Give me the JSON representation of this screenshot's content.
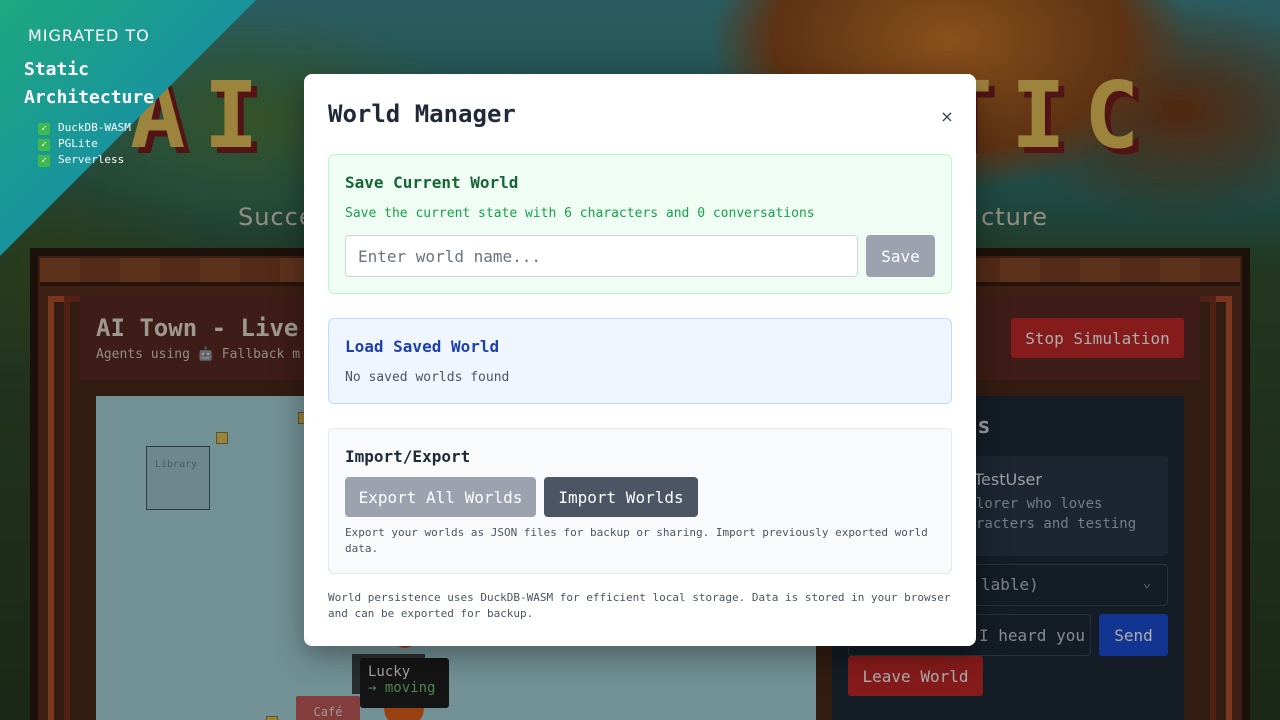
{
  "ribbon": {
    "top": "MIGRATED TO",
    "headline_1": "Static",
    "headline_2": "Architecture",
    "items": [
      "DuckDB-WASM",
      "PGLite",
      "Serverless"
    ]
  },
  "background": {
    "title": "AI TOWN STATIC",
    "subtitle_start": "Succe",
    "subtitle_end": "cture"
  },
  "simulation": {
    "title": "AI Town - Live",
    "subtitle": "Agents using 🤖 Fallback m",
    "stop_label": "Stop Simulation",
    "map": {
      "library_label": "Library",
      "cafe_label": "Café",
      "tooltip_name": "Lucky",
      "tooltip_status": "→ moving"
    },
    "side": {
      "title": "ls",
      "char_name": "TestUser",
      "char_desc": "lorer who loves racters and testing",
      "select_value": "lable)",
      "message_value": "I heard you",
      "send_label": "Send",
      "leave_label": "Leave World"
    }
  },
  "modal": {
    "title": "World Manager",
    "close_label": "×",
    "save_section": {
      "title": "Save Current World",
      "description": "Save the current state with 6 characters and 0 conversations",
      "input_placeholder": "Enter world name...",
      "save_label": "Save"
    },
    "load_section": {
      "title": "Load Saved World",
      "empty_text": "No saved worlds found"
    },
    "import_export": {
      "title": "Import/Export",
      "export_label": "Export All Worlds",
      "import_label": "Import Worlds",
      "description": "Export your worlds as JSON files for backup or sharing. Import previously exported world data."
    },
    "footnote": "World persistence uses DuckDB-WASM for efficient local storage. Data is stored in your browser and can be exported for backup."
  },
  "colors": {
    "save_accent": "#166534",
    "load_accent": "#1e40af",
    "danger": "#c62828",
    "primary": "#1d4ed8"
  }
}
